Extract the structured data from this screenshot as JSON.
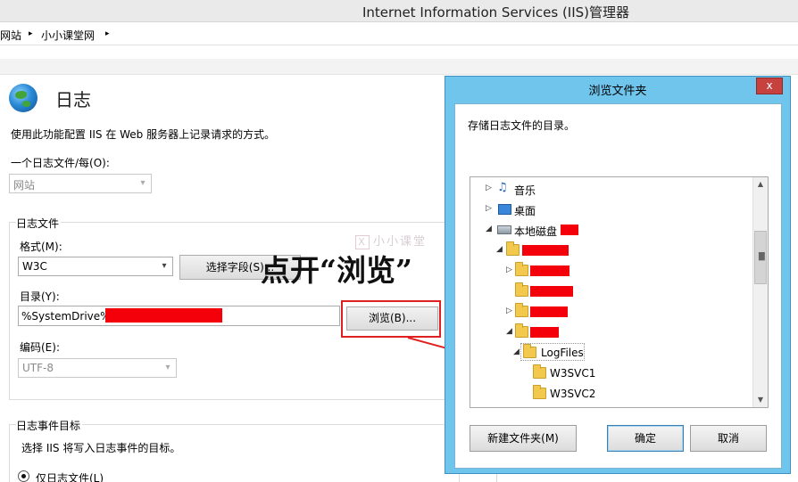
{
  "window": {
    "title": "Internet Information Services (IIS)管理器"
  },
  "address_bar": {
    "crumbs": [
      "网站",
      "小小课堂网"
    ],
    "separator": "▸"
  },
  "page": {
    "title": "日志",
    "description": "使用此功能配置 IIS 在 Web 服务器上记录请求的方式。",
    "one_log_per_label": "一个日志文件/每(O):",
    "one_log_per_value": "网站",
    "log_file_group": "日志文件",
    "format_label": "格式(M):",
    "format_value": "W3C",
    "select_fields_button": "选择字段(S)...",
    "directory_label": "目录(Y):",
    "directory_value": "%SystemDrive%",
    "browse_button": "浏览(B)...",
    "encoding_label": "编码(E):",
    "encoding_value": "UTF-8",
    "event_target_group": "日志事件目标",
    "event_target_desc": "选择 IIS 将写入日志事件的目标。",
    "radio_log_only": "仅日志文件(L)"
  },
  "overlay": {
    "watermark_mark": "X",
    "watermark_text": "小小课堂",
    "annotation": "点开“浏览”"
  },
  "dialog": {
    "title": "浏览文件夹",
    "close_label": "x",
    "prompt": "存储日志文件的目录。",
    "tree": {
      "music": "音乐",
      "desktop": "桌面",
      "local_disk": "本地磁盘",
      "logfiles": "LogFiles",
      "w3svc1": "W3SVC1",
      "w3svc2": "W3SVC2"
    },
    "new_folder_button": "新建文件夹(M)",
    "ok_button": "确定",
    "cancel_button": "取消"
  },
  "icons": {
    "dropdown": "▾",
    "expand": "▷",
    "collapse": "◢",
    "scroll_up": "▲",
    "scroll_down": "▼"
  },
  "colors": {
    "accent_dialog": "#6fc5ec",
    "redaction": "#f3000b",
    "highlight": "#e02020"
  }
}
